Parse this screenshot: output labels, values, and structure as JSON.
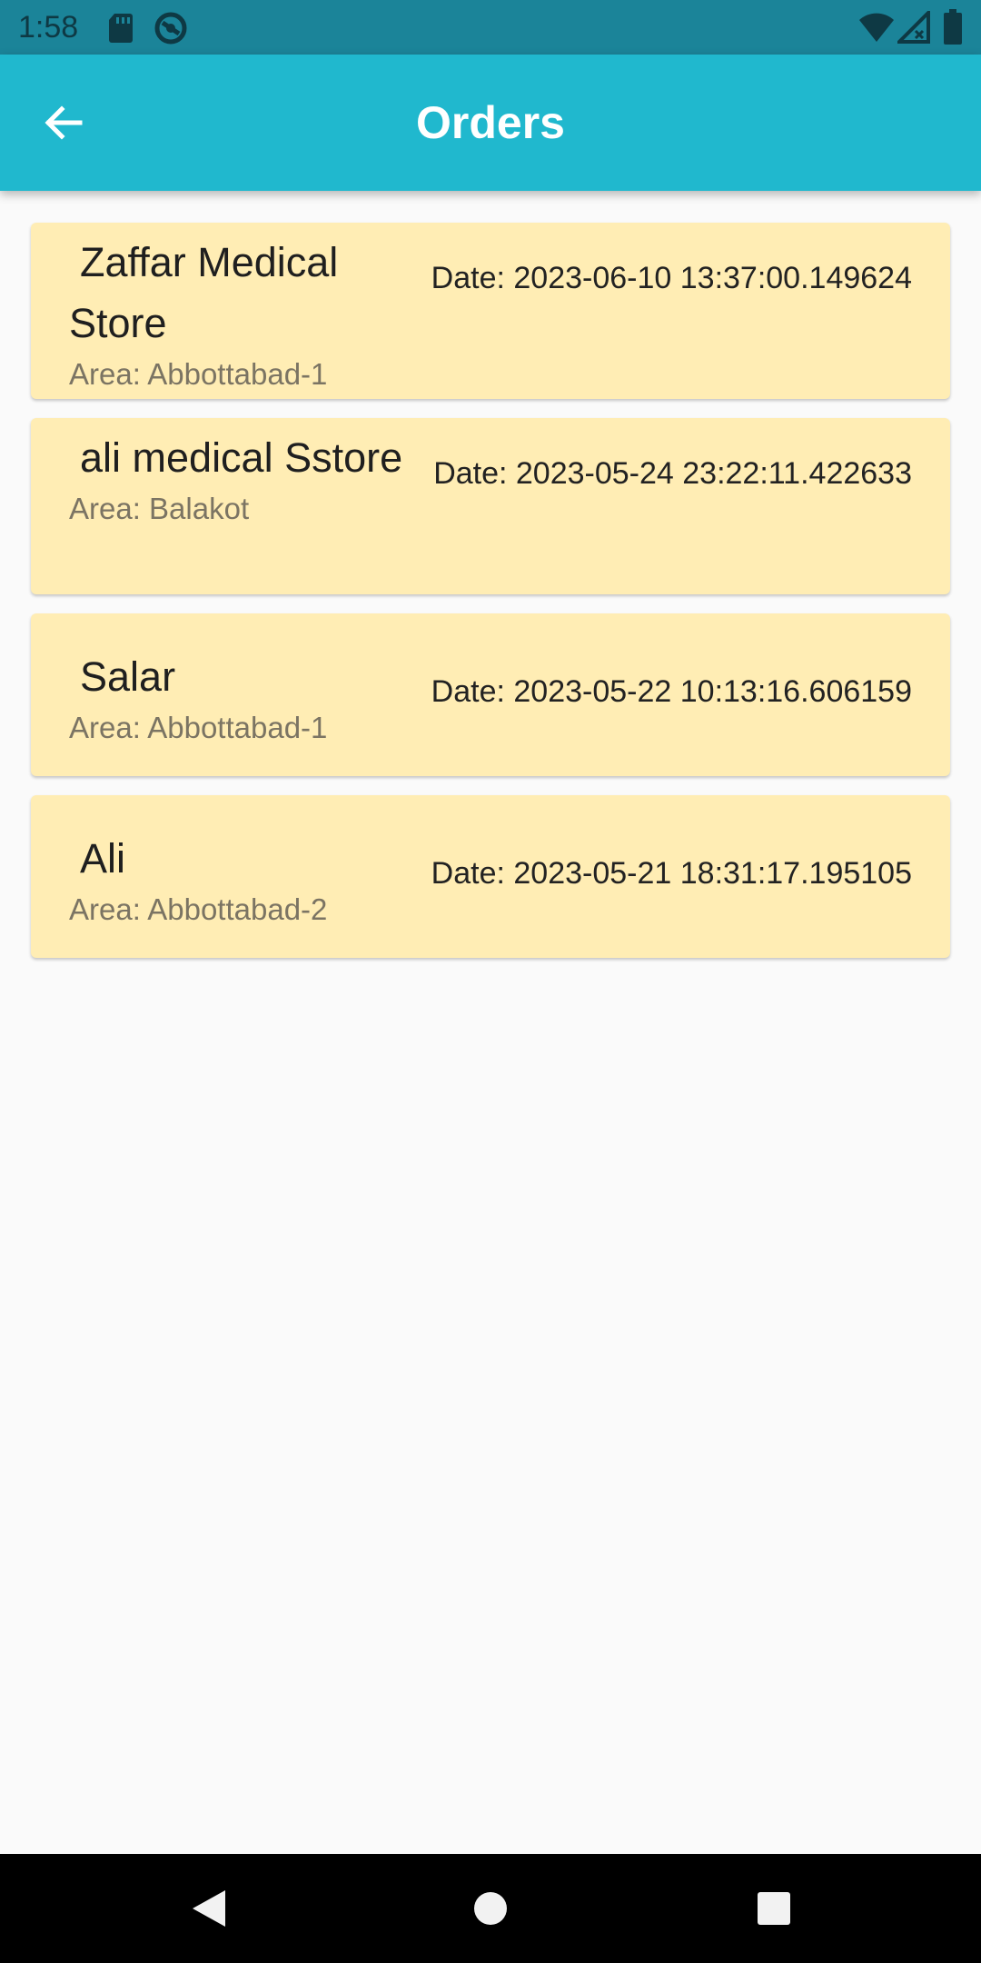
{
  "status_bar": {
    "time": "1:58",
    "icons": [
      "sd-card-icon",
      "sync-icon",
      "wifi-icon",
      "cell-signal-icon",
      "battery-icon"
    ]
  },
  "app_bar": {
    "title": "Orders",
    "back_icon": "arrow-back-icon"
  },
  "orders": [
    {
      "store": "Zaffar Medical Store",
      "area": "Area: Abbottabad-1",
      "date": "Date: 2023-06-10 13:37:00.149624"
    },
    {
      "store": "ali medical Sstore",
      "area": "Area: Balakot",
      "date": "Date: 2023-05-24 23:22:11.422633"
    },
    {
      "store": "Salar",
      "area": "Area: Abbottabad-1",
      "date": "Date: 2023-05-22 10:13:16.606159"
    },
    {
      "store": "Ali",
      "area": "Area: Abbottabad-2",
      "date": "Date: 2023-05-21 18:31:17.195105"
    }
  ],
  "nav_bar": {
    "icons": [
      "back-triangle-icon",
      "home-circle-icon",
      "recents-square-icon"
    ]
  },
  "colors": {
    "status_bar": "#1b8499",
    "app_bar": "#20b8ce",
    "card": "#ffedb4",
    "background": "#fafafa"
  }
}
